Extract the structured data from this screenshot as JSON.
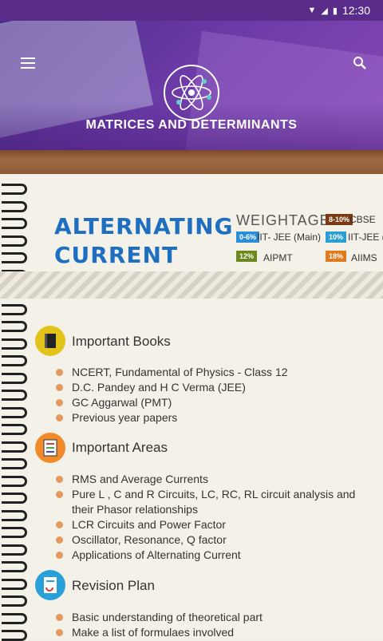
{
  "status_bar": {
    "time": "12:30"
  },
  "header": {
    "title": "MATRICES AND DETERMINANTS"
  },
  "topic": {
    "title_line1": "ALTERNATING",
    "title_line2": "CURRENT"
  },
  "weightage": {
    "label": "WEIGHTAGE:",
    "chips": [
      {
        "value": "8-10%",
        "exam": "CBSE",
        "color": "#7a3a14"
      },
      {
        "value": "0-6%",
        "exam": "IIT- JEE (Main)",
        "color": "#2a8fd6"
      },
      {
        "value": "10%",
        "exam": "IIT-JEE (A",
        "color": "#2a9fd0"
      },
      {
        "value": "12%",
        "exam": "AIPMT",
        "color": "#6a8a1e"
      },
      {
        "value": "18%",
        "exam": "AIIMS",
        "color": "#e07a1e"
      }
    ]
  },
  "sections": [
    {
      "title": "Important Books",
      "icon": "book-icon",
      "items": [
        "NCERT, Fundamental of Physics - Class 12",
        "D.C. Pandey and H C Verma (JEE)",
        "GC Aggarwal (PMT)",
        "Previous year papers"
      ]
    },
    {
      "title": "Important Areas",
      "icon": "checklist-icon",
      "items": [
        "RMS and Average Currents",
        "Pure L , C and R Circuits, LC, RC, RL circuit analysis and",
        "their Phasor relationships",
        "LCR Circuits and Power Factor",
        "Oscillator, Resonance, Q factor",
        "Applications of Alternating Current"
      ]
    },
    {
      "title": "Revision Plan",
      "icon": "revision-icon",
      "items": [
        "Basic understanding of theoretical part",
        "Make a list of formulaes involved"
      ]
    }
  ]
}
